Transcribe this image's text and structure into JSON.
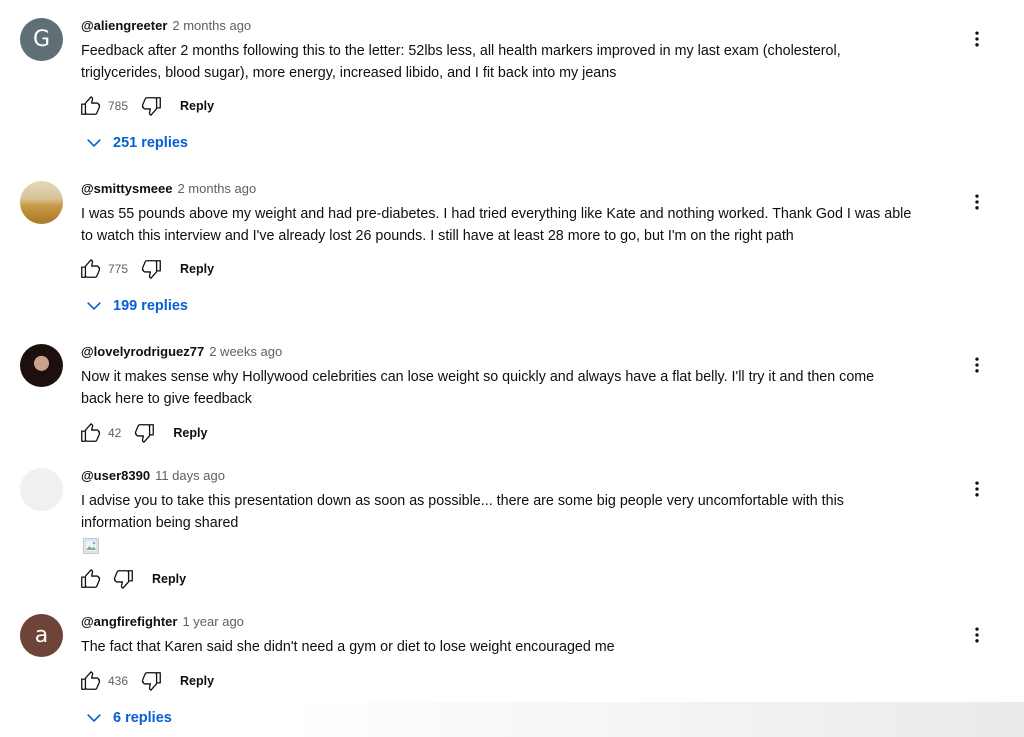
{
  "comments": [
    {
      "author": "@aliengreeter",
      "time": "2 months ago",
      "avatar_letter": "G",
      "lines": [
        "Feedback after 2 months following this to the letter: 52lbs less, all health markers improved in my last exam (cholesterol,",
        "triglycerides, blood sugar), more energy, increased libido, and I fit back into my jeans"
      ],
      "likes": "785",
      "reply_label": "Reply",
      "replies_label": "251 replies"
    },
    {
      "author": "@smittysmeee",
      "time": "2 months ago",
      "lines": [
        "I was 55 pounds above my weight and had pre-diabetes. I had tried everything like Kate and nothing worked. Thank God I was able",
        "to watch this interview and I've already lost 26 pounds. I still have at least 28 more to go, but I'm on the right path"
      ],
      "likes": "775",
      "reply_label": "Reply",
      "replies_label": "199 replies"
    },
    {
      "author": "@lovelyrodriguez77",
      "time": "2 weeks ago",
      "lines": [
        "Now it makes sense why Hollywood celebrities can lose weight so quickly and always have a flat belly. I'll try it and then come",
        "back here to give feedback"
      ],
      "likes": "42",
      "reply_label": "Reply"
    },
    {
      "author": "@user8390",
      "time": "11 days ago",
      "lines": [
        "I advise you to take this presentation down as soon as possible... there are some big people very uncomfortable with this",
        "information being shared"
      ],
      "reply_label": "Reply"
    },
    {
      "author": "@angfirefighter",
      "time": "1 year ago",
      "avatar_letter": "a",
      "lines": [
        "The fact that Karen said she didn't need a gym or diet to lose weight encouraged me"
      ],
      "likes": "436",
      "reply_label": "Reply",
      "replies_label": "6 replies"
    }
  ],
  "colors": {
    "link_blue": "#065fd4",
    "secondary_text": "#606060",
    "primary_text": "#0f0f0f"
  },
  "icons": [
    "thumbs-up-icon",
    "thumbs-down-icon",
    "more-vert-icon",
    "chevron-down-icon",
    "broken-image-icon"
  ]
}
